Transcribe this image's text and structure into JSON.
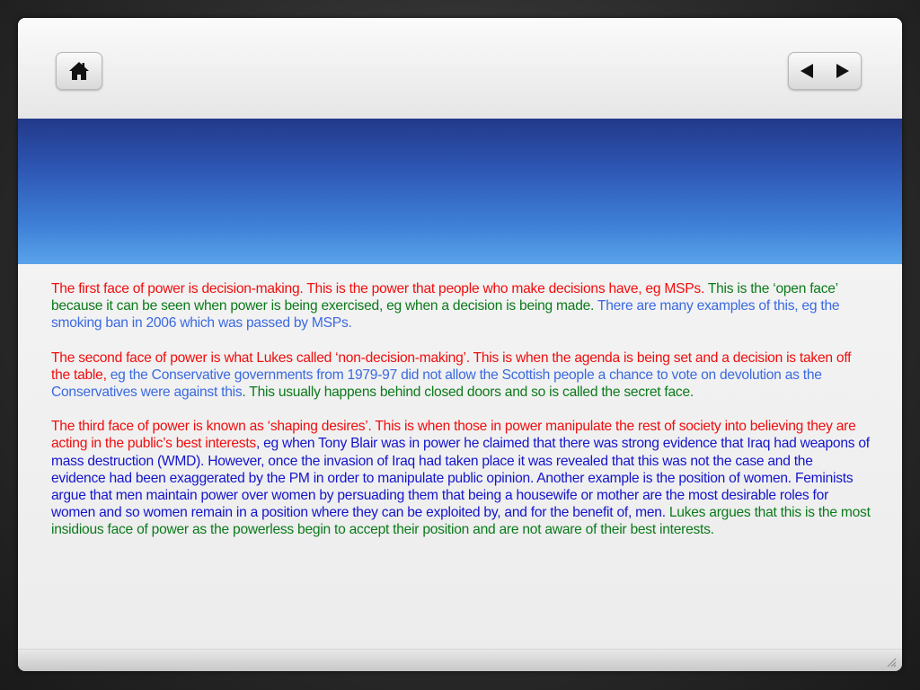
{
  "navigation": {
    "home_icon": "home-icon",
    "prev_icon": "triangle-left-icon",
    "next_icon": "triangle-right-icon"
  },
  "colors": {
    "red": "#f00d0d",
    "green": "#0b7a1a",
    "light_blue": "#3a69e0",
    "dark_blue": "#1414cc",
    "band": "#2e57b4"
  },
  "paragraphs": [
    {
      "segments": [
        {
          "color": "red",
          "text": "The first face of power is decision-making. This is the power that people who make decisions have, eg MSPs. "
        },
        {
          "color": "green",
          "text": "This is the ‘open face’ because it can be seen when power is being exercised, eg when a decision is being made. "
        },
        {
          "color": "light_blue",
          "text": "There are many examples of this, eg the smoking ban in 2006 which was passed by MSPs."
        }
      ]
    },
    {
      "segments": [
        {
          "color": "red",
          "text": "The second face of power is what Lukes called ‘non-decision-making’. This is when the agenda is being set and a decision is taken off the table, "
        },
        {
          "color": "light_blue",
          "text": "eg the Conservative governments from 1979-97 did not allow the Scottish people a chance to vote on devolution as the Conservatives were against this"
        },
        {
          "color": "green",
          "text": ". This usually happens behind closed doors and so is called the secret face."
        }
      ]
    },
    {
      "segments": [
        {
          "color": "red",
          "text": "The third face of power is known as ‘shaping desires’. This is when those in power manipulate the rest of society into believing they are acting in the public’s best interests"
        },
        {
          "color": "dark_blue",
          "text": ", eg when Tony Blair was in power he claimed that there was strong evidence that Iraq had weapons of mass destruction (WMD). However, once the invasion of Iraq had taken place it was revealed that this was not the case and the evidence had been exaggerated by the PM in order to manipulate public opinion. Another example is the position of women. Feminists argue that men maintain power over women by persuading them that being a housewife or mother are the most desirable roles for women and so women remain in a position where they can be exploited by, and for the benefit of, men. "
        },
        {
          "color": "green",
          "text": "Lukes argues that this is the most insidious face of power as the powerless begin to accept their position and are not aware of their best interests."
        }
      ]
    }
  ]
}
